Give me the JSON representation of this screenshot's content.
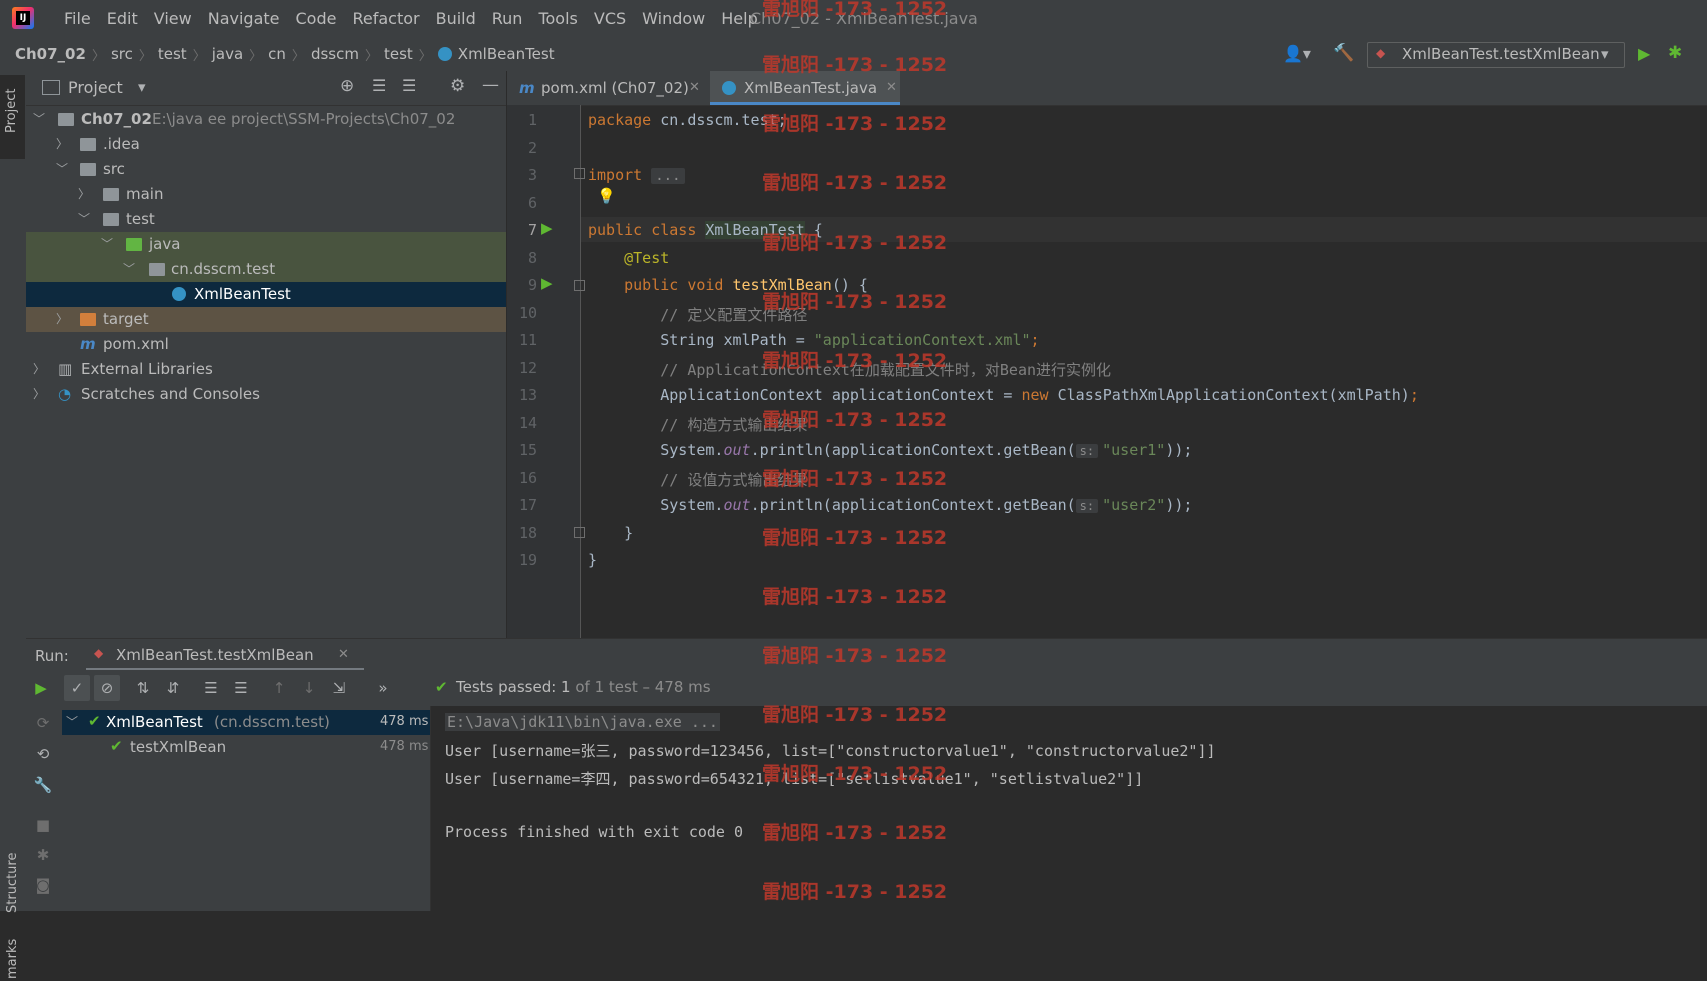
{
  "menubar": {
    "items": [
      "File",
      "Edit",
      "View",
      "Navigate",
      "Code",
      "Refactor",
      "Build",
      "Run",
      "Tools",
      "VCS",
      "Window",
      "Help"
    ],
    "window_title": "Ch07_02 - XmlBeanTest.java"
  },
  "breadcrumbs": [
    "Ch07_02",
    "src",
    "test",
    "java",
    "cn",
    "dsscm",
    "test",
    "XmlBeanTest"
  ],
  "run_config": "XmlBeanTest.testXmlBean",
  "project_panel": {
    "title": "Project",
    "side_tab": "Project",
    "tree": [
      {
        "label": "Ch07_02",
        "path": "E:\\java ee project\\SSM-Projects\\Ch07_02"
      },
      {
        "label": ".idea"
      },
      {
        "label": "src"
      },
      {
        "label": "main"
      },
      {
        "label": "test"
      },
      {
        "label": "java"
      },
      {
        "label": "cn.dsscm.test"
      },
      {
        "label": "XmlBeanTest"
      },
      {
        "label": "target"
      },
      {
        "label": "pom.xml"
      },
      {
        "label": "External Libraries"
      },
      {
        "label": "Scratches and Consoles"
      }
    ]
  },
  "editor": {
    "tabs": [
      "pom.xml (Ch07_02)",
      "XmlBeanTest.java"
    ],
    "line_numbers": [
      "1",
      "2",
      "3",
      "6",
      "7",
      "8",
      "9",
      "10",
      "11",
      "12",
      "13",
      "14",
      "15",
      "16",
      "17",
      "18",
      "19"
    ],
    "lines": {
      "l1_kw": "package",
      "l1_rest": " cn.dsscm.test;",
      "l3_kw": "import",
      "l3_fold": "...",
      "l7_kw": "public class",
      "l7_name": "XmlBeanTest",
      "l7_rest": " {",
      "l8_ann": "@Test",
      "l9_kw": "public void",
      "l9_fn": "testXmlBean",
      "l9_rest": "() {",
      "l10_cm": "// 定义配置文件路径",
      "l11_a": "String xmlPath = ",
      "l11_str": "\"applicationContext.xml\"",
      "l11_end": ";",
      "l12_cm": "// ApplicationContext在加载配置文件时，对Bean进行实例化",
      "l13_a": "ApplicationContext applicationContext = ",
      "l13_kw": "new",
      "l13_b": " ClassPathXmlApplicationContext(xmlPath)",
      "l13_end": ";",
      "l14_cm": "// 构造方式输出结果",
      "l15_a": "System.",
      "l15_st": "out",
      "l15_b": ".println(applicationContext.getBean(",
      "l15_hint": "s:",
      "l15_str": "\"user1\"",
      "l15_end": "));",
      "l16_cm": "// 设值方式输出结果",
      "l17_a": "System.",
      "l17_st": "out",
      "l17_b": ".println(applicationContext.getBean(",
      "l17_hint": "s:",
      "l17_str": "\"user2\"",
      "l17_end": "));",
      "l18": "}",
      "l19": "}"
    }
  },
  "run_panel": {
    "label": "Run:",
    "tab": "XmlBeanTest.testXmlBean",
    "status_prefix": "Tests passed: ",
    "status_count": "1",
    "status_suffix": " of 1 test – 478 ms",
    "tests": [
      {
        "name": "XmlBeanTest",
        "pkg": "(cn.dsscm.test)",
        "time": "478 ms"
      },
      {
        "name": "testXmlBean",
        "time": "478 ms"
      }
    ],
    "console": [
      "E:\\Java\\jdk11\\bin\\java.exe ...",
      "User [username=张三, password=123456, list=[\"constructorvalue1\", \"constructorvalue2\"]]",
      "User [username=李四, password=654321, list=[\"setlistvalue1\", \"setlistvalue2\"]]",
      "",
      "Process finished with exit code 0"
    ],
    "side_tabs": [
      "Structure",
      "marks"
    ]
  },
  "watermark": "雷旭阳 -173 - 1252",
  "colors": {
    "accent": "#4a88c7",
    "keyword": "#cc7832",
    "string": "#6a8759",
    "comment": "#808080",
    "pass": "#5fb832",
    "watermark": "#c0392b"
  }
}
